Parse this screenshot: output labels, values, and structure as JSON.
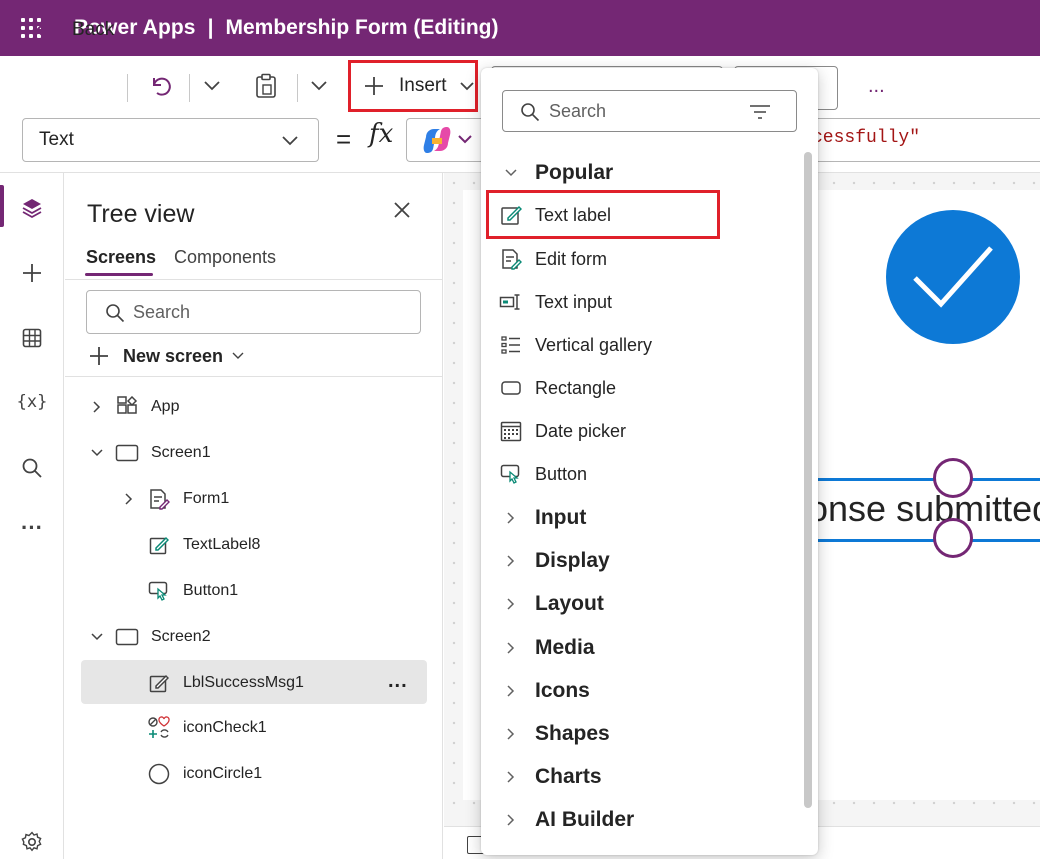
{
  "header": {
    "app_name": "Power Apps",
    "separator": "|",
    "document_title": "Membership Form (Editing)"
  },
  "toolbar": {
    "back_label": "Back",
    "insert_label": "Insert",
    "more_label": "..."
  },
  "formula_bar": {
    "property": "Text",
    "equals": "=",
    "fx": "fx",
    "formula_visible": "cessfully\""
  },
  "tree_view": {
    "title": "Tree view",
    "tabs": [
      {
        "label": "Screens",
        "active": true
      },
      {
        "label": "Components",
        "active": false
      }
    ],
    "search_placeholder": "Search",
    "new_screen_label": "New screen",
    "nodes": [
      {
        "label": "App",
        "icon": "app-icon"
      },
      {
        "label": "Screen1",
        "icon": "screen-icon",
        "expanded": true
      },
      {
        "label": "Form1",
        "icon": "form-icon"
      },
      {
        "label": "TextLabel8",
        "icon": "label-icon"
      },
      {
        "label": "Button1",
        "icon": "button-icon"
      },
      {
        "label": "Screen2",
        "icon": "screen-icon",
        "expanded": true
      },
      {
        "label": "LblSuccessMsg1",
        "icon": "label-icon",
        "selected": true
      },
      {
        "label": "iconCheck1",
        "icon": "icons-icon"
      },
      {
        "label": "iconCircle1",
        "icon": "circle-icon"
      }
    ],
    "selected_more": "..."
  },
  "canvas": {
    "label_text": "onse submitted"
  },
  "insert_menu": {
    "search_placeholder": "Search",
    "popular_label": "Popular",
    "items": [
      {
        "label": "Text label",
        "icon": "text-label-icon"
      },
      {
        "label": "Edit form",
        "icon": "edit-form-icon"
      },
      {
        "label": "Text input",
        "icon": "text-input-icon"
      },
      {
        "label": "Vertical gallery",
        "icon": "gallery-icon"
      },
      {
        "label": "Rectangle",
        "icon": "rectangle-icon"
      },
      {
        "label": "Date picker",
        "icon": "calendar-icon"
      },
      {
        "label": "Button",
        "icon": "button-icon"
      }
    ],
    "categories": [
      "Input",
      "Display",
      "Layout",
      "Media",
      "Icons",
      "Shapes",
      "Charts",
      "AI Builder"
    ]
  },
  "colors": {
    "brand": "#742774",
    "highlight": "#e0202a",
    "accent_blue": "#0d79d6"
  }
}
